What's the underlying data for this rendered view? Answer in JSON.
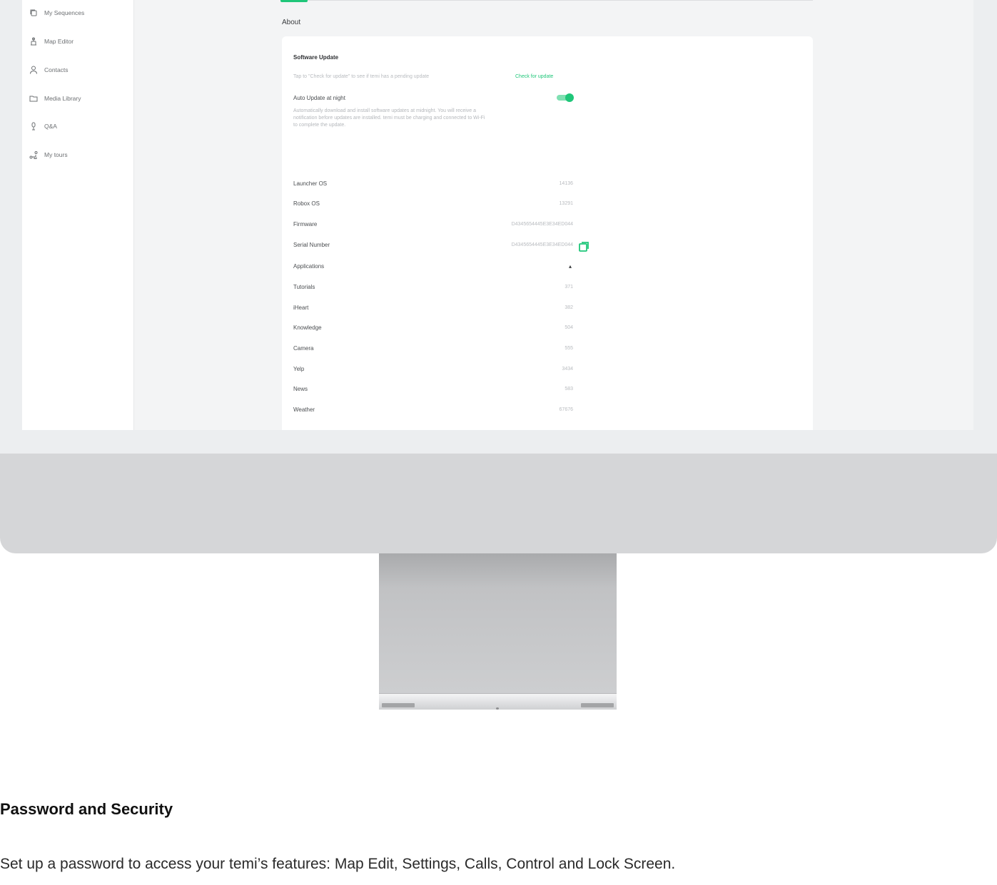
{
  "sidebar": {
    "items": [
      {
        "label": "My Sequences",
        "icon": "sequences-icon"
      },
      {
        "label": "Map Editor",
        "icon": "map-editor-icon"
      },
      {
        "label": "Contacts",
        "icon": "contacts-icon"
      },
      {
        "label": "Media Library",
        "icon": "folder-icon"
      },
      {
        "label": "Q&A",
        "icon": "microphone-icon"
      },
      {
        "label": "My tours",
        "icon": "tours-icon"
      }
    ]
  },
  "main": {
    "section_title": "About",
    "software_update": {
      "title": "Software Update",
      "hint": "Tap to \"Check for update\" to see if temi has a pending update",
      "check_link": "Check for update",
      "auto_update_label": "Auto Update at night",
      "auto_update_desc": "Automatically download and install software updates at midnight. You will receive a notification before updates are installed. temi must be charging and connected to Wi-Fi to complete the update.",
      "auto_update_on": true
    },
    "info_rows": [
      {
        "label": "Launcher OS",
        "value": "14136"
      },
      {
        "label": "Robox OS",
        "value": "13291"
      },
      {
        "label": "Firmware",
        "value": "D4345654445E3E34ED044"
      },
      {
        "label": "Serial Number",
        "value": "D4345654445E3E34ED044"
      },
      {
        "label": "Applications",
        "value": "▴"
      },
      {
        "label": "Tutorials",
        "value": "371"
      },
      {
        "label": "iHeart",
        "value": "382"
      },
      {
        "label": "Knowledge",
        "value": "504"
      },
      {
        "label": "Camera",
        "value": "555"
      },
      {
        "label": "Yelp",
        "value": "3434"
      },
      {
        "label": "News",
        "value": "583"
      },
      {
        "label": "Weather",
        "value": "67676"
      }
    ]
  },
  "page": {
    "heading": "Password and Security",
    "paragraph": "Set up a password to access your temi’s features: Map Edit, Settings, Calls, Control and Lock Screen."
  },
  "colors": {
    "accent": "#1fc679",
    "monitor_body": "#d5d6d8",
    "bezel": "#eceef0"
  }
}
